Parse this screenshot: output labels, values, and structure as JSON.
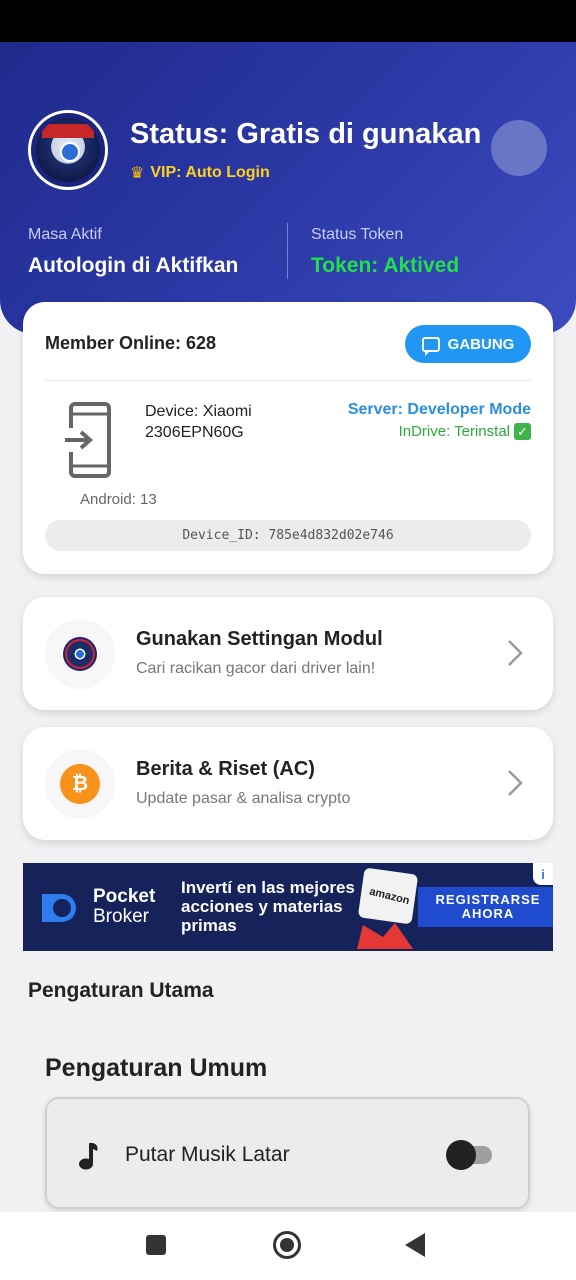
{
  "header": {
    "status_title": "Status: Gratis di gunakan",
    "vip_label": "VIP: Auto Login",
    "masa_aktif_label": "Masa Aktif",
    "masa_aktif_value": "Autologin di Aktifkan",
    "status_token_label": "Status Token",
    "status_token_value": "Token: Aktived",
    "colors": {
      "gradient_start": "#1f2a8c",
      "gradient_end": "#3c4cc0",
      "vip": "#ffd21f",
      "token": "#22e04a"
    }
  },
  "member_card": {
    "member_online": "Member Online: 628",
    "join_button": "GABUNG",
    "device_name": "Device: Xiaomi 2306EPN60G",
    "server": "Server: Developer Mode",
    "indrive": "InDrive: Terinstal",
    "android": "Android: 13",
    "device_id": "Device_ID: 785e4d832d02e746",
    "colors": {
      "button": "#2196f3",
      "server": "#2a8ee0",
      "indrive": "#2eaa3c"
    }
  },
  "menu": [
    {
      "title": "Gunakan Settingan Modul",
      "subtitle": "Cari racikan gacor dari driver lain!",
      "icon": "module-logo-icon"
    },
    {
      "title": "Berita & Riset (AC)",
      "subtitle": "Update pasar & analisa crypto",
      "icon": "bitcoin-icon"
    }
  ],
  "ad": {
    "brand_line1": "Pocket",
    "brand_line2": "Broker",
    "copy": "Invertí en las mejores acciones y materias primas",
    "product_label": "amazon",
    "cta": "REGISTRARSE AHORA",
    "info": "i"
  },
  "settings": {
    "section_title": "Pengaturan Utama",
    "group_title": "Pengaturan Umum",
    "items": [
      {
        "label": "Putar Musik Latar",
        "enabled": false,
        "icon": "music-note-icon"
      }
    ]
  },
  "navbar": {
    "icons": [
      "recent-apps-icon",
      "home-icon",
      "back-icon"
    ]
  }
}
